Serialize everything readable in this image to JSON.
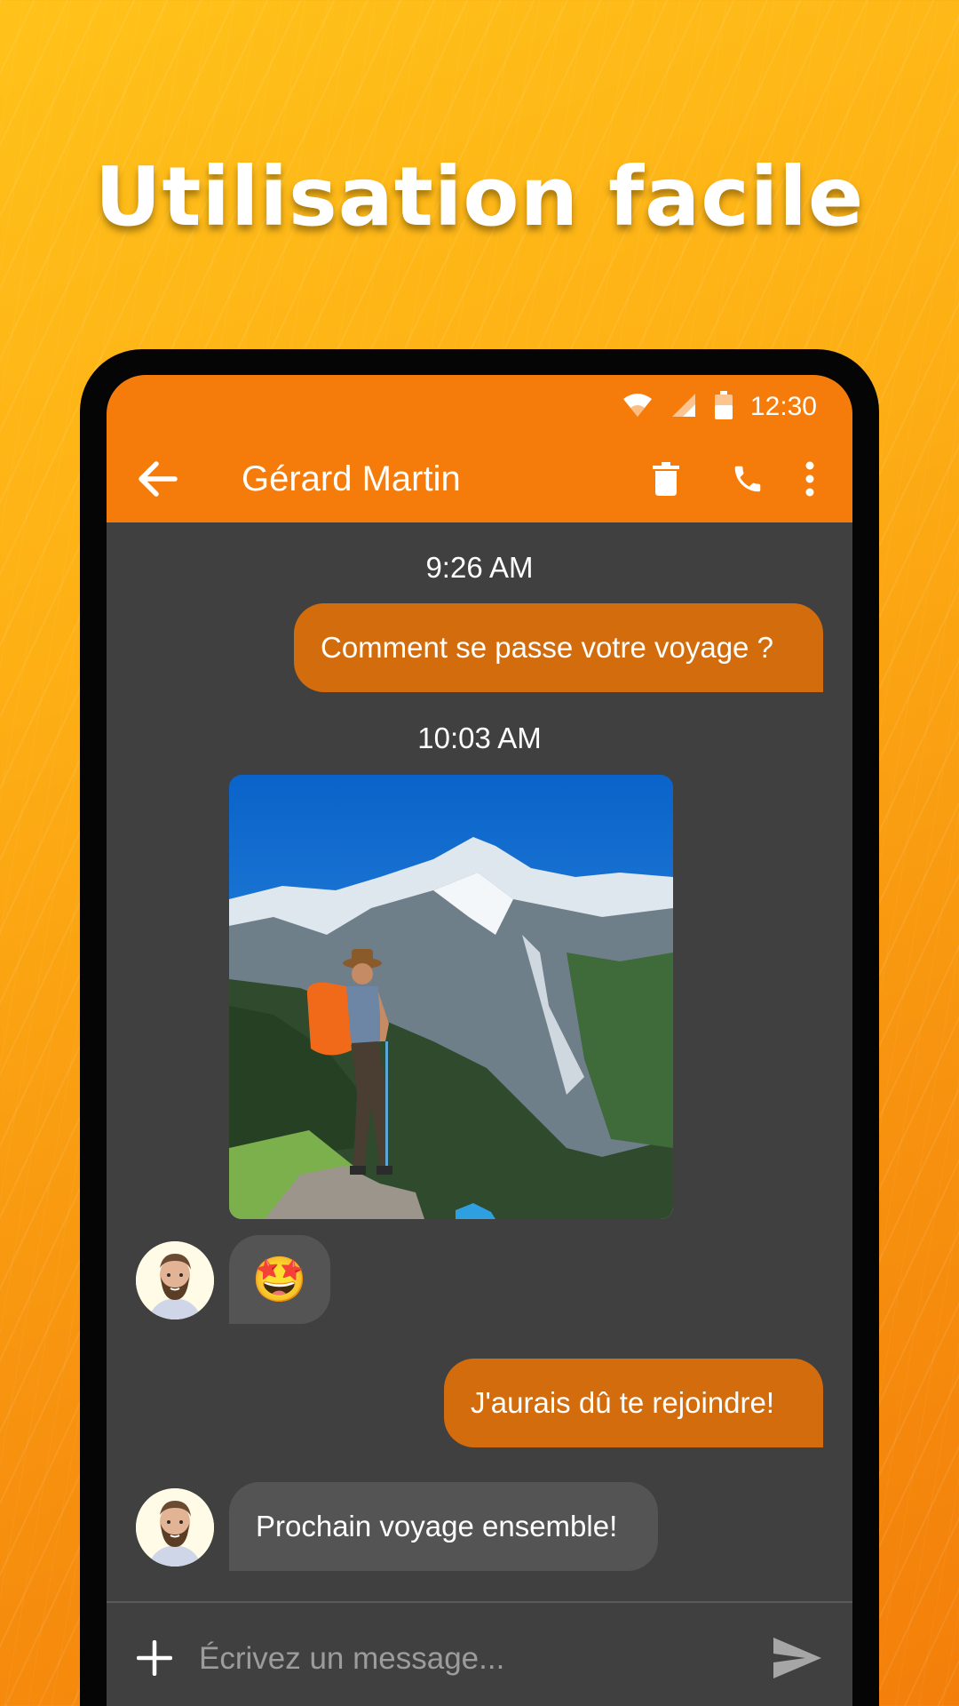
{
  "headline": "Utilisation facile",
  "colors": {
    "accent": "#f57c0a",
    "outgoing_bubble": "#d36c0c",
    "incoming_bubble": "#545454",
    "screen_background": "#404040"
  },
  "status_bar": {
    "time": "12:30",
    "icons": [
      "wifi-icon",
      "cell-signal-icon",
      "battery-icon"
    ]
  },
  "app_bar": {
    "contact_name": "Gérard Martin",
    "icons": [
      "back-arrow-icon",
      "trash-icon",
      "phone-icon",
      "more-vert-icon"
    ]
  },
  "conversation": {
    "timestamp_1": "9:26 AM",
    "message_1": "Comment se passe votre voyage ?",
    "timestamp_2": "10:03 AM",
    "message_2_emoji": "🤩",
    "message_3": "J'aurais dû te rejoindre!",
    "message_4": "Prochain voyage ensemble!"
  },
  "composer": {
    "placeholder": "Écrivez un message...",
    "icons": [
      "add-icon",
      "send-icon"
    ]
  }
}
